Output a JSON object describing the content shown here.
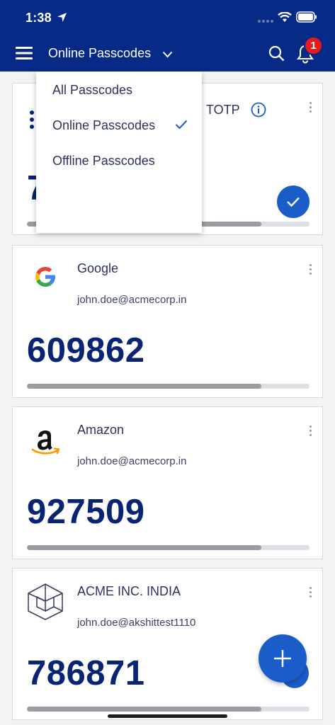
{
  "status_bar": {
    "time": "1:38"
  },
  "header": {
    "title": "Online Passcodes",
    "notification_count": "1"
  },
  "dropdown": {
    "items": [
      {
        "label": "All Passcodes",
        "selected": false
      },
      {
        "label": "Online Passcodes",
        "selected": true
      },
      {
        "label": "Offline Passcodes",
        "selected": false
      }
    ]
  },
  "cards": [
    {
      "title_fragment": "TOTP",
      "code_fragment": "7",
      "progress": 0.83
    },
    {
      "title": "Google",
      "email": "john.doe@acmecorp.in",
      "code": "609862",
      "progress": 0.83,
      "logo": "google-logo-icon"
    },
    {
      "title": "Amazon",
      "email": "john.doe@acmecorp.in",
      "code": "927509",
      "progress": 0.83,
      "logo": "amazon-logo-icon"
    },
    {
      "title": "ACME INC. INDIA",
      "email": "john.doe@akshittest1110",
      "code": "786871",
      "progress": 0.83,
      "logo": "acme-cube-logo-icon"
    }
  ],
  "colors": {
    "header_bg": "#062a86",
    "accent": "#1a5dc9",
    "code_text": "#0a2474",
    "badge": "#e71b1b"
  }
}
